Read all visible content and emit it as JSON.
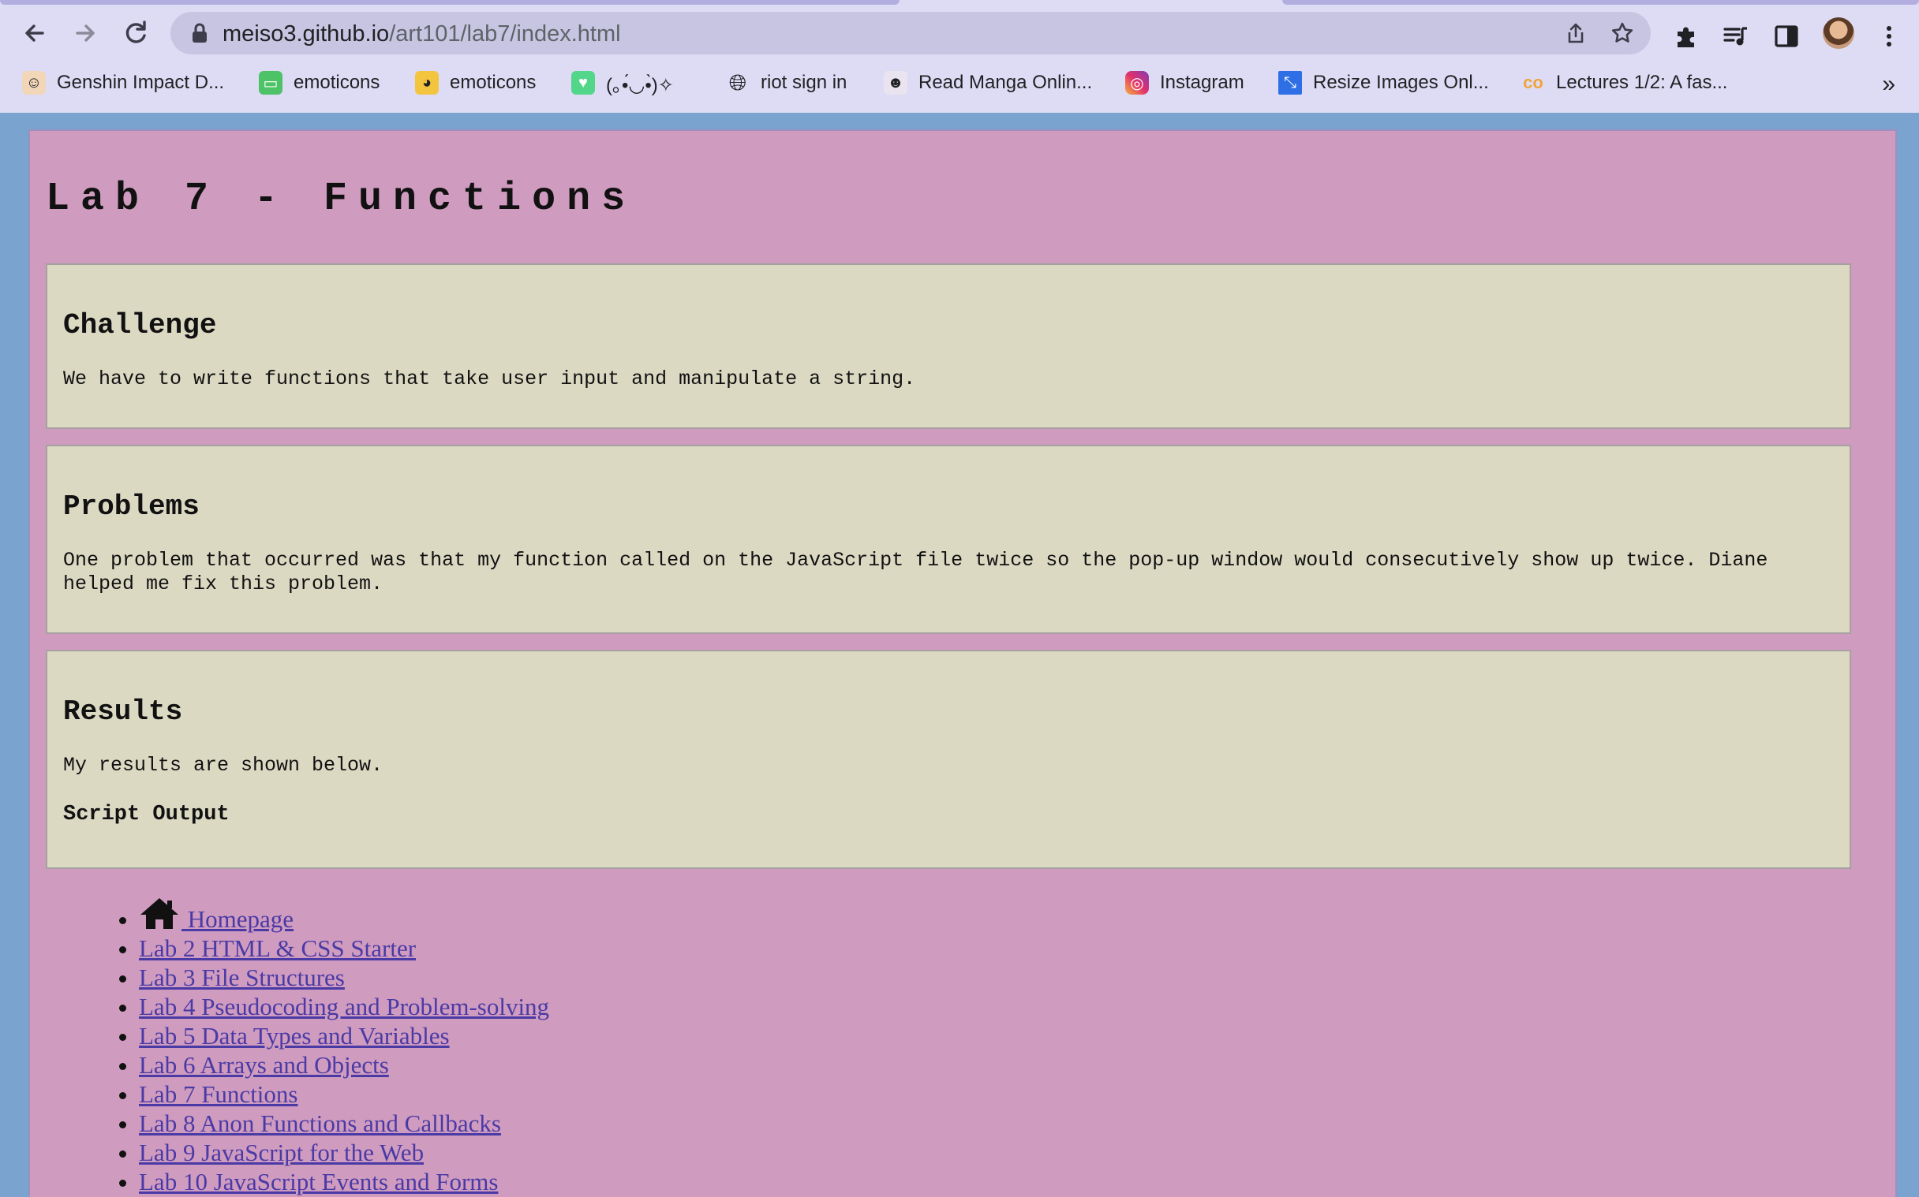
{
  "browser": {
    "url_host": "meiso3.github.io",
    "url_path": "/art101/lab7/index.html",
    "bookmarks": [
      {
        "label": "Genshin Impact D...",
        "icon": "genshin-avatar-icon"
      },
      {
        "label": "emoticons",
        "icon": "green-chat-icon"
      },
      {
        "label": "emoticons",
        "icon": "cartoon-face-icon"
      },
      {
        "label": "(｡•́◡•̀)✧",
        "icon": "green-heart-icon"
      },
      {
        "label": "riot sign in",
        "icon": "globe-icon"
      },
      {
        "label": "Read Manga Onlin...",
        "icon": "manga-mascot-icon"
      },
      {
        "label": "Instagram",
        "icon": "instagram-icon"
      },
      {
        "label": "Resize Images Onl...",
        "icon": "resize-icon"
      },
      {
        "label": "Lectures 1/2: A fas...",
        "icon": "coursera-co-icon"
      }
    ],
    "more_bookmarks": "»"
  },
  "page": {
    "title": "Lab 7 - Functions",
    "sections": [
      {
        "heading": "Challenge",
        "body": "We have to write functions that take user input and manipulate a string."
      },
      {
        "heading": "Problems",
        "body": "One problem that occurred was that my function called on the JavaScript file twice so the pop-up window would consecutively show up twice. Diane helped me fix this problem."
      },
      {
        "heading": "Results",
        "body": "My results are shown below.",
        "subheading": "Script Output"
      }
    ],
    "nav_links": [
      " Homepage",
      "Lab 2 HTML & CSS Starter",
      "Lab 3 File Structures",
      "Lab 4 Pseudocoding and Problem-solving",
      "Lab 5 Data Types and Variables",
      "Lab 6 Arrays and Objects",
      "Lab 7 Functions",
      "Lab 8 Anon Functions and Callbacks",
      "Lab 9 JavaScript for the Web",
      "Lab 10 JavaScript Events and Forms"
    ]
  },
  "colors": {
    "page_background": "#cf9bbf",
    "section_background": "#dcd9c3",
    "outer_background": "#7aa4cf",
    "link": "#4a3aa5"
  }
}
